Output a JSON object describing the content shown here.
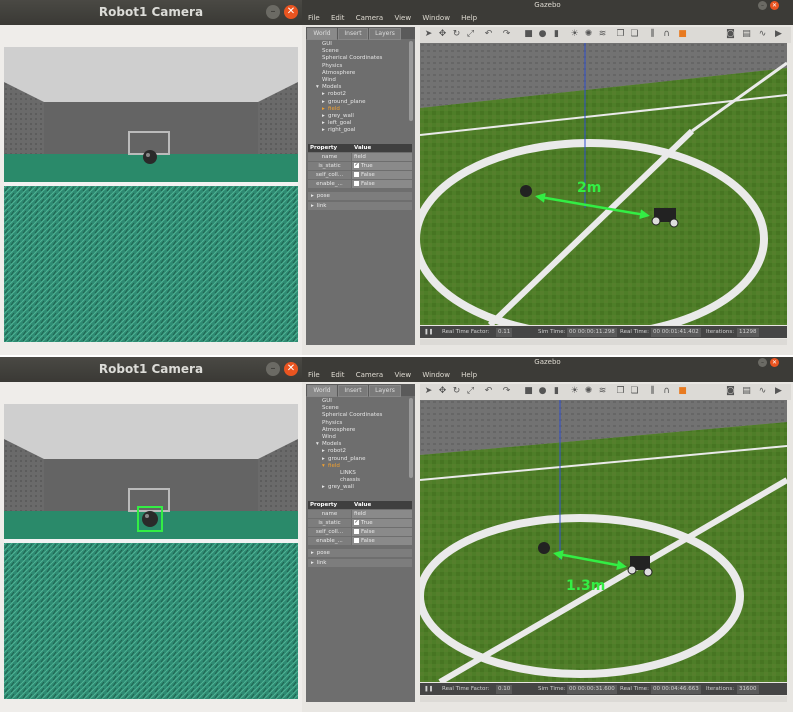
{
  "panels": [
    {
      "camera": {
        "title": "Robot1 Camera",
        "detection_box": false
      },
      "gazebo": {
        "title": "Gazebo",
        "menu": [
          "File",
          "Edit",
          "Camera",
          "View",
          "Window",
          "Help"
        ],
        "tabs": [
          "World",
          "Insert",
          "Layers"
        ],
        "tree": [
          {
            "label": "GUI",
            "indent": 0,
            "arrow": "",
            "selected": false
          },
          {
            "label": "Scene",
            "indent": 0,
            "arrow": "",
            "selected": false
          },
          {
            "label": "Spherical Coordinates",
            "indent": 0,
            "arrow": "",
            "selected": false
          },
          {
            "label": "Physics",
            "indent": 0,
            "arrow": "",
            "selected": false
          },
          {
            "label": "Atmosphere",
            "indent": 0,
            "arrow": "",
            "selected": false
          },
          {
            "label": "Wind",
            "indent": 0,
            "arrow": "",
            "selected": false
          },
          {
            "label": "Models",
            "indent": 0,
            "arrow": "▾",
            "selected": false
          },
          {
            "label": "robot2",
            "indent": 1,
            "arrow": "▸",
            "selected": false
          },
          {
            "label": "ground_plane",
            "indent": 1,
            "arrow": "▸",
            "selected": false
          },
          {
            "label": "field",
            "indent": 1,
            "arrow": "▸",
            "selected": true
          },
          {
            "label": "grey_wall",
            "indent": 1,
            "arrow": "▸",
            "selected": false
          },
          {
            "label": "left_goal",
            "indent": 1,
            "arrow": "▸",
            "selected": false
          },
          {
            "label": "right_goal",
            "indent": 1,
            "arrow": "▸",
            "selected": false
          }
        ],
        "props_header": [
          "Property",
          "Value"
        ],
        "props": [
          {
            "k": "name",
            "v": "field",
            "check": ""
          },
          {
            "k": "is_static",
            "v": "True",
            "check": "✓"
          },
          {
            "k": "self_coll...",
            "v": "False",
            "check": " "
          },
          {
            "k": "enable_...",
            "v": "False",
            "check": " "
          }
        ],
        "expanders": [
          {
            "label": "pose",
            "arrow": "▸"
          },
          {
            "label": "link",
            "arrow": "▸"
          }
        ],
        "distance_label": "2m",
        "status": {
          "rtf_label": "Real Time Factor:",
          "rtf": "0.11",
          "sim_label": "Sim Time:",
          "sim": "00 00:00:11.298",
          "real_label": "Real Time:",
          "real": "00 00:01:41.402",
          "iter_label": "Iterations:",
          "iter": "11298"
        }
      }
    },
    {
      "camera": {
        "title": "Robot1 Camera",
        "detection_box": true
      },
      "gazebo": {
        "title": "Gazebo",
        "menu": [
          "File",
          "Edit",
          "Camera",
          "View",
          "Window",
          "Help"
        ],
        "tabs": [
          "World",
          "Insert",
          "Layers"
        ],
        "tree": [
          {
            "label": "GUI",
            "indent": 0,
            "arrow": "",
            "selected": false
          },
          {
            "label": "Scene",
            "indent": 0,
            "arrow": "",
            "selected": false
          },
          {
            "label": "Spherical Coordinates",
            "indent": 0,
            "arrow": "",
            "selected": false
          },
          {
            "label": "Physics",
            "indent": 0,
            "arrow": "",
            "selected": false
          },
          {
            "label": "Atmosphere",
            "indent": 0,
            "arrow": "",
            "selected": false
          },
          {
            "label": "Wind",
            "indent": 0,
            "arrow": "",
            "selected": false
          },
          {
            "label": "Models",
            "indent": 0,
            "arrow": "▾",
            "selected": false
          },
          {
            "label": "robot2",
            "indent": 1,
            "arrow": "▸",
            "selected": false
          },
          {
            "label": "ground_plane",
            "indent": 1,
            "arrow": "▸",
            "selected": false
          },
          {
            "label": "field",
            "indent": 1,
            "arrow": "▾",
            "selected": true
          },
          {
            "label": "LINKS",
            "indent": 3,
            "arrow": "",
            "selected": false
          },
          {
            "label": "chassis",
            "indent": 3,
            "arrow": "",
            "selected": false
          },
          {
            "label": "grey_wall",
            "indent": 1,
            "arrow": "▸",
            "selected": false
          }
        ],
        "props_header": [
          "Property",
          "Value"
        ],
        "props": [
          {
            "k": "name",
            "v": "field",
            "check": ""
          },
          {
            "k": "is_static",
            "v": "True",
            "check": "✓"
          },
          {
            "k": "self_coll...",
            "v": "False",
            "check": " "
          },
          {
            "k": "enable_...",
            "v": "False",
            "check": " "
          }
        ],
        "expanders": [
          {
            "label": "pose",
            "arrow": "▸"
          },
          {
            "label": "link",
            "arrow": "▸"
          }
        ],
        "distance_label": "1.3m",
        "status": {
          "rtf_label": "Real Time Factor:",
          "rtf": "0.10",
          "sim_label": "Sim Time:",
          "sim": "00 00:00:31.600",
          "real_label": "Real Time:",
          "real": "00 00:04:46.663",
          "iter_label": "Iterations:",
          "iter": "31600"
        }
      }
    }
  ],
  "colors": {
    "field_green": "#4a7a26",
    "turf_teal": "#2f8a74",
    "arrow_green": "#33ee44",
    "title_bar": "#3c3b37",
    "close_orange": "#e95420"
  }
}
